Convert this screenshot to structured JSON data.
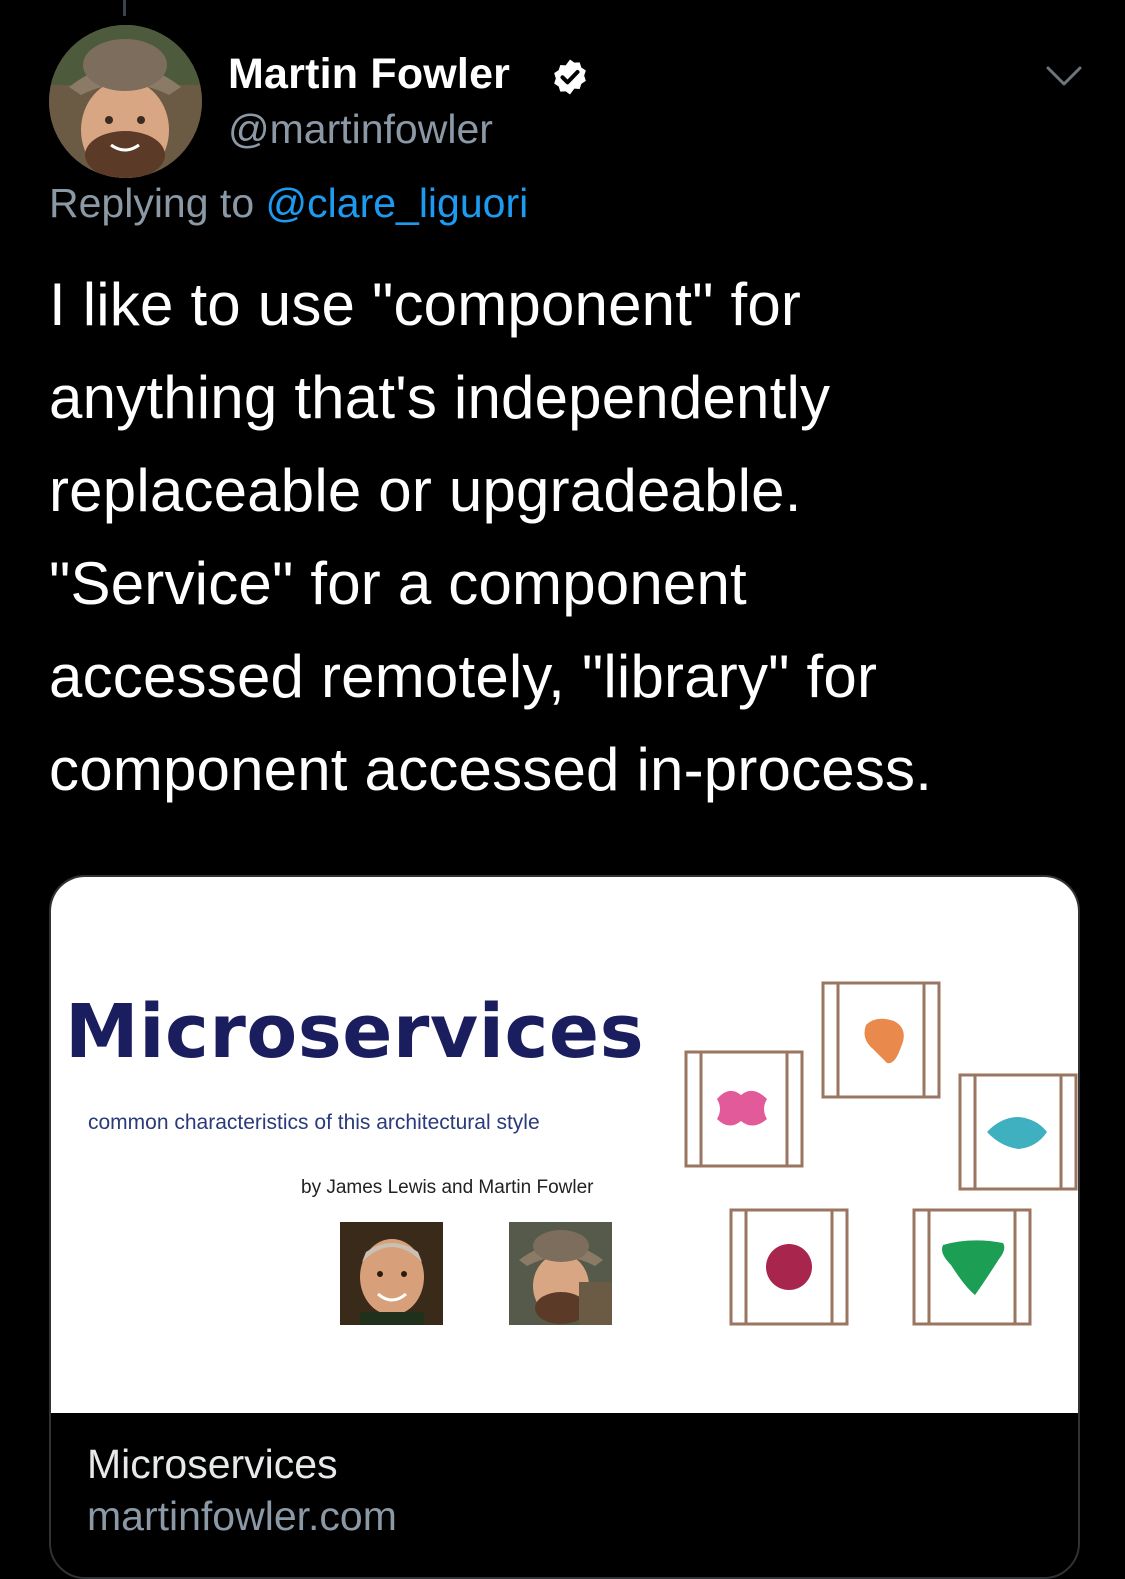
{
  "tweet": {
    "author": {
      "display_name": "Martin Fowler",
      "handle": "@martinfowler",
      "verified_icon": "verified-badge-icon"
    },
    "reply": {
      "prefix": "Replying to",
      "mention": "@clare_liguori"
    },
    "text": "I like to use \"component\" for\nanything that's independently\nreplaceable or upgradeable.\n\"Service\" for a component\naccessed remotely, \"library\" for\ncomponent accessed in-process.",
    "menu_icon": "chevron-down-icon"
  },
  "card": {
    "image": {
      "title": "Microservices",
      "subtitle": "common characteristics of this architectural style",
      "byline": "by James Lewis and Martin Fowler"
    },
    "title": "Microservices",
    "domain": "martinfowler.com"
  },
  "colors": {
    "background": "#000000",
    "secondary_text": "#8b98a5",
    "link": "#1d9bf0",
    "ms_title": "#1b1e5e",
    "box_stroke": "#9a7560",
    "blob_pink": "#e35a9a",
    "blob_orange": "#e98a4c",
    "blob_teal": "#3fb0c0",
    "blob_crimson": "#a8264d",
    "blob_green": "#1d9e55"
  }
}
